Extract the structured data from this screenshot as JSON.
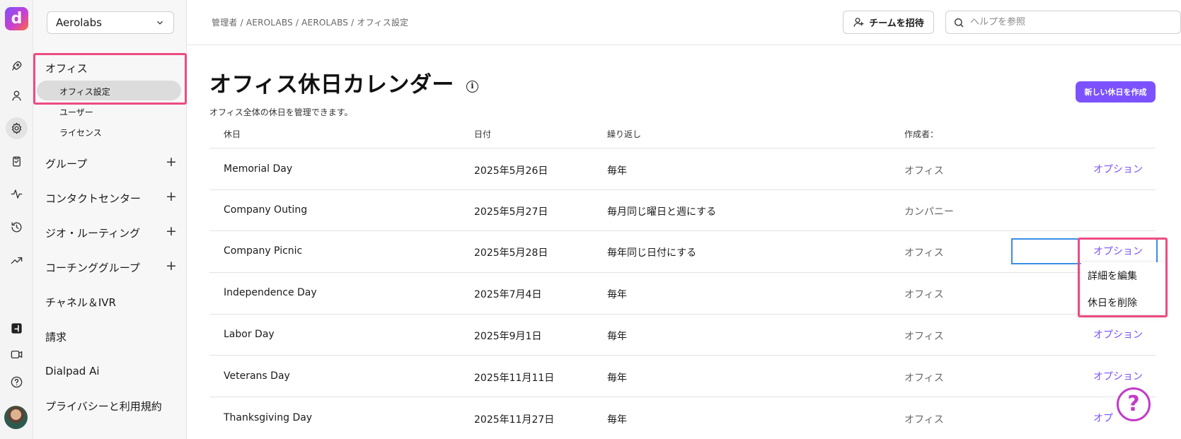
{
  "rail": {
    "logo": "d",
    "icons": [
      "rocket-icon",
      "person-icon",
      "gear-icon",
      "clipboard-icon",
      "activity-icon",
      "history-icon",
      "trending-icon",
      "dialpad-ai-icon",
      "video-icon",
      "help-circle-icon",
      "avatar"
    ]
  },
  "sidebar": {
    "org_name": "Aerolabs",
    "office": "オフィス",
    "office_settings": "オフィス設定",
    "users": "ユーザー",
    "licenses": "ライセンス",
    "groups": "グループ",
    "contact_center": "コンタクトセンター",
    "geo_routing": "ジオ・ルーティング",
    "coaching_groups": "コーチンググループ",
    "channels_ivr": "チャネル＆IVR",
    "billing": "請求",
    "dialpad_ai": "Dialpad Ai",
    "privacy": "プライバシーと利用規約"
  },
  "topbar": {
    "breadcrumb": "管理者 / AEROLABS / AEROLABS / オフィス設定",
    "invite_label": "チームを招待",
    "search_placeholder": "ヘルプを参照"
  },
  "main": {
    "title": "オフィス休日カレンダー",
    "subtitle": "オフィス全体の休日を管理できます。",
    "create_button": "新しい休日を作成",
    "columns": {
      "holiday": "休日",
      "date": "日付",
      "repeat": "繰り返し",
      "creator": "作成者："
    },
    "rows": [
      {
        "name": "Memorial Day",
        "date": "2025年5月26日",
        "repeat": "毎年",
        "creator": "オフィス",
        "option": "オプション"
      },
      {
        "name": "Company Outing",
        "date": "2025年5月27日",
        "repeat": "毎月同じ曜日と週にする",
        "creator": "カンパニー",
        "option": ""
      },
      {
        "name": "Company Picnic",
        "date": "2025年5月28日",
        "repeat": "毎年同じ日付にする",
        "creator": "オフィス",
        "option": "オプション"
      },
      {
        "name": "Independence Day",
        "date": "2025年7月4日",
        "repeat": "毎年",
        "creator": "オフィス",
        "option": ""
      },
      {
        "name": "Labor Day",
        "date": "2025年9月1日",
        "repeat": "毎年",
        "creator": "オフィス",
        "option": "オプション"
      },
      {
        "name": "Veterans Day",
        "date": "2025年11月11日",
        "repeat": "毎年",
        "creator": "オフィス",
        "option": "オプション"
      },
      {
        "name": "Thanksgiving Day",
        "date": "2025年11月27日",
        "repeat": "毎年",
        "creator": "オフィス",
        "option": "オプ"
      }
    ],
    "dropdown": {
      "edit": "詳細を編集",
      "delete": "休日を削除"
    },
    "help_fab": "?"
  },
  "colors": {
    "accent": "#7c52ff",
    "highlight": "#ee4b82",
    "focus": "#3a8ee6"
  }
}
